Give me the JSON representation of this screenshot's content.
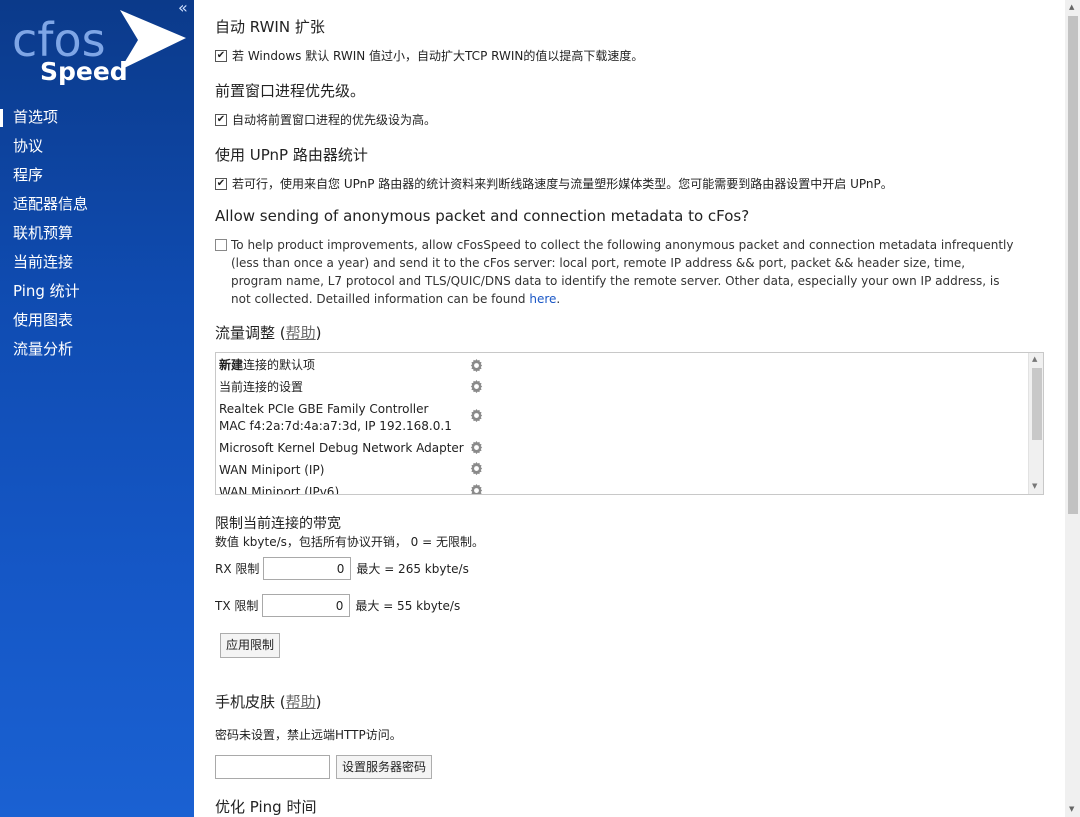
{
  "sidebar": {
    "logo_line1": "cfos",
    "logo_line2": "Speed",
    "collapse": "«",
    "items": [
      {
        "label": "首选项"
      },
      {
        "label": "协议"
      },
      {
        "label": "程序"
      },
      {
        "label": "适配器信息"
      },
      {
        "label": "联机预算"
      },
      {
        "label": "当前连接"
      },
      {
        "label": "Ping 统计"
      },
      {
        "label": "使用图表"
      },
      {
        "label": "流量分析"
      }
    ]
  },
  "settings": {
    "rwin": {
      "title": "自动 RWIN 扩张",
      "checkbox": "若 Windows 默认 RWIN 值过小，自动扩大TCP RWIN的值以提高下载速度。",
      "checked": true
    },
    "foreground": {
      "title": "前置窗口进程优先级。",
      "checkbox": "自动将前置窗口进程的优先级设为高。",
      "checked": true
    },
    "upnp": {
      "title": "使用 UPnP 路由器统计",
      "checkbox": "若可行，使用来自您 UPnP 路由器的统计资料来判断线路速度与流量塑形媒体类型。您可能需要到路由器设置中开启 UPnP。",
      "checked": true
    },
    "metadata": {
      "title": "Allow sending of anonymous packet and connection metadata to cFos?",
      "text": "To help product improvements, allow cFosSpeed to collect the following anonymous packet and connection metadata infrequently (less than once a year) and send it to the cFos server: local port, remote IP address && port, packet && header size, time, program name, L7 protocol and TLS/QUIC/DNS data to identify the remote server. Other data, especially your own IP address, is not collected. Detailled information can be found ",
      "link": "here",
      "after_link": ".",
      "checked": false
    },
    "shaping": {
      "title": "流量调整",
      "help_open": "(",
      "help": "帮助",
      "help_close": ")",
      "rows": [
        {
          "bold": "新建",
          "text": "连接的默认项"
        },
        {
          "text": "当前连接的设置"
        },
        {
          "text": "Realtek PCIe GBE Family Controller",
          "sub": "MAC f4:2a:7d:4a:a7:3d, IP 192.168.0.1"
        },
        {
          "text": "Microsoft Kernel Debug Network Adapter"
        },
        {
          "text": "WAN Miniport (IP)"
        },
        {
          "text": "WAN Miniport (IPv6)"
        }
      ]
    },
    "limit": {
      "title": "限制当前连接的带宽",
      "subtitle": "数值 kbyte/s，包括所有协议开销， 0 = 无限制。",
      "rx_label": "RX 限制",
      "rx_value": "0",
      "rx_max": "最大 = 265 kbyte/s",
      "tx_label": "TX 限制",
      "tx_value": "0",
      "tx_max": "最大 = 55 kbyte/s",
      "apply": "应用限制"
    },
    "mobile": {
      "title": "手机皮肤",
      "help_open": "(",
      "help": "帮助",
      "help_close": ")",
      "status": "密码未设置，禁止远端HTTP访问。",
      "password_value": "",
      "button": "设置服务器密码"
    },
    "ping": {
      "title": "优化 Ping 时间"
    }
  },
  "colors": {
    "sidebar_top": "#0b3a8a",
    "sidebar_bottom": "#1a61d2",
    "link": "#1a57c6"
  }
}
